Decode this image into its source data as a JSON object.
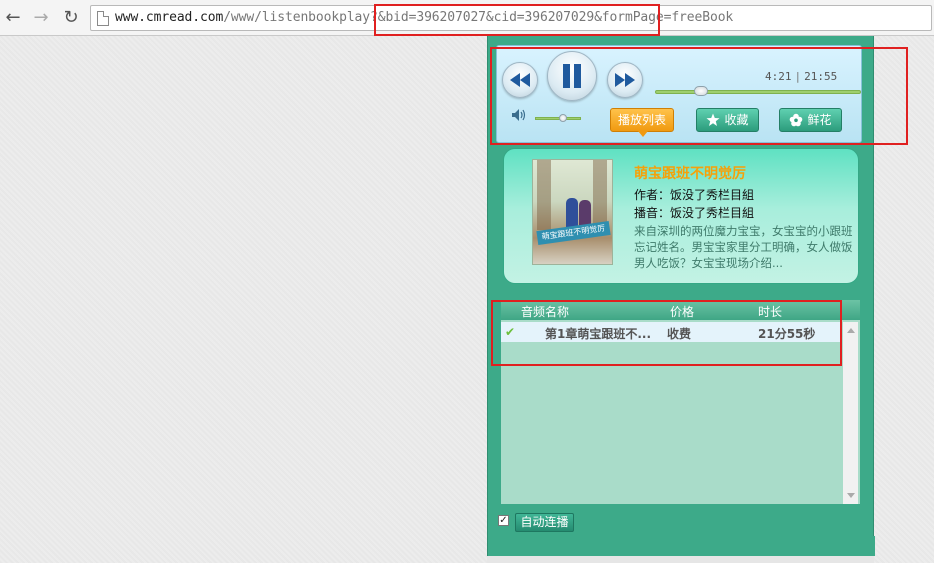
{
  "browser": {
    "url_domain": "www.cmread.com",
    "url_path": "/www/listenbookplay?&bid=396207027&cid=396207029&formPage=freeBook",
    "back_icon": "arrow-left-icon",
    "forward_icon": "arrow-right-icon",
    "reload_icon": "reload-icon"
  },
  "player": {
    "current_time": "4:21",
    "total_time": "21:55",
    "separator": "|",
    "progress_fraction": 0.2,
    "volume_fraction": 0.6,
    "state": "playing",
    "buttons": {
      "playlist": "播放列表",
      "collect": "收藏",
      "flower": "鲜花"
    }
  },
  "book": {
    "title": "萌宝跟班不明觉厉",
    "author": "作者：饭没了秀栏目組",
    "narrator": "播音：饭没了秀栏目組",
    "description": "来自深圳的两位魔力宝宝，女宝宝的小跟班忘记姓名。男宝宝家里分工明确，女人做饭男人吃饭？女宝宝现场介绍...",
    "cover_text": "萌宝跟班不明觉厉"
  },
  "chapter_list": {
    "headers": [
      "音频名称",
      "价格",
      "时长"
    ],
    "rows": [
      {
        "name": "第1章萌宝跟班不...",
        "price": "收费",
        "duration": "21分55秒",
        "played": true
      }
    ]
  },
  "autoplay": {
    "label": "自动连播",
    "checked": true
  },
  "colors": {
    "widget_bg": "#3daa89",
    "accent_orange": "#f09a10",
    "title_orange": "#f5a10a",
    "annotation_red": "#e02020"
  }
}
